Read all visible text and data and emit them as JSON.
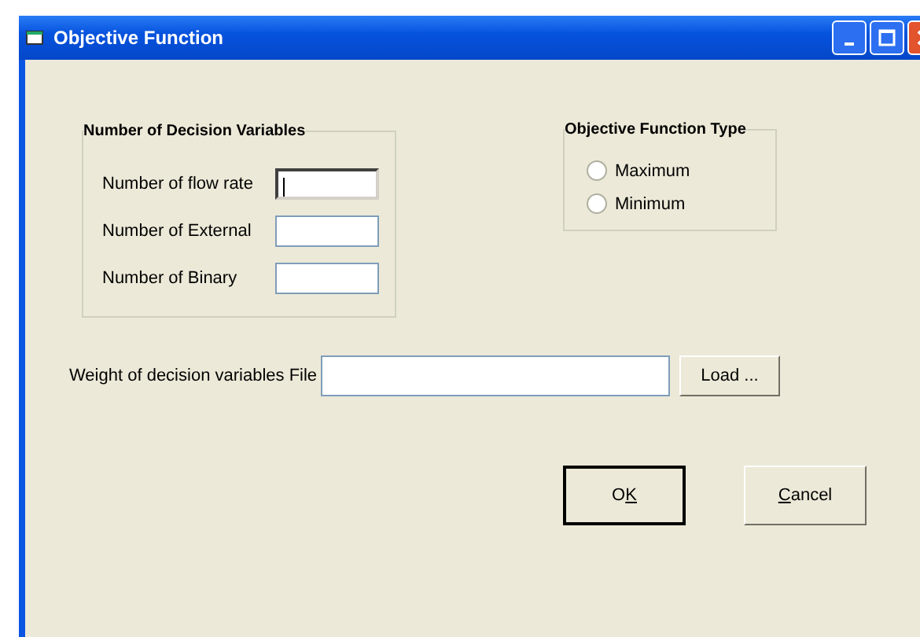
{
  "window": {
    "title": "Objective Function"
  },
  "decision_variables": {
    "title": "Number of Decision Variables",
    "fields": [
      {
        "label": "Number of flow rate",
        "focused": true
      },
      {
        "label": "Number of External",
        "focused": false
      },
      {
        "label": "Number of Binary",
        "focused": false
      }
    ]
  },
  "objective_type": {
    "title": "Objective Function Type",
    "options": [
      {
        "label": "Maximum",
        "selected": false
      },
      {
        "label": "Minimum",
        "selected": false
      }
    ]
  },
  "weight_file": {
    "label": "Weight of decision variables File",
    "button": "Load ..."
  },
  "buttons": [
    {
      "parts": [
        {
          "text": "O",
          "underlined": false
        },
        {
          "text": "K",
          "underlined": true
        }
      ]
    },
    {
      "parts": [
        {
          "text": "C",
          "underlined": true
        },
        {
          "text": "ancel",
          "underlined": false
        }
      ]
    }
  ]
}
